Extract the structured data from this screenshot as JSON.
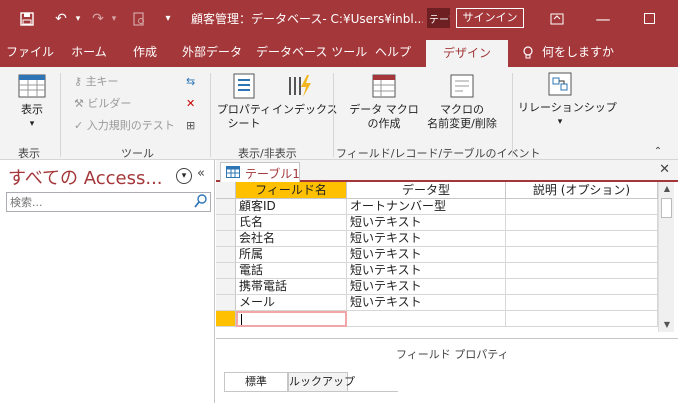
{
  "title_bar": {
    "title": "顧客管理：データベース- C:¥Users¥inbl...",
    "context_tab": "テーブル ツール",
    "signin_label": "サインイン"
  },
  "ribbon_tabs": [
    "ファイル",
    "ホーム",
    "作成",
    "外部データ",
    "データベース ツール",
    "ヘルプ",
    "デザイン"
  ],
  "tell_me": "何をしますか",
  "ribbon": {
    "view_label": "表示",
    "primary_key": "主キー",
    "builder": "ビルダー",
    "test_rules": "入力規則のテスト",
    "property_sheet": [
      "プロパティ",
      "シート"
    ],
    "indexes": "インデックス",
    "data_macro": [
      "データ マクロ",
      "の作成"
    ],
    "rename_macro": [
      "マクロの",
      "名前変更/削除"
    ],
    "relationships": "リレーションシップ",
    "groups": [
      "表示",
      "ツール",
      "表示/非表示",
      "フィールド/レコード/テーブルのイベント"
    ]
  },
  "nav_pane": {
    "title": "すべての Access...",
    "search_placeholder": "検索..."
  },
  "document": {
    "tab_label": "テーブル1",
    "columns": [
      "フィールド名",
      "データ型",
      "説明 (オプション)"
    ],
    "rows": [
      {
        "field": "顧客ID",
        "type": "オートナンバー型"
      },
      {
        "field": "氏名",
        "type": "短いテキスト"
      },
      {
        "field": "会社名",
        "type": "短いテキスト"
      },
      {
        "field": "所属",
        "type": "短いテキスト"
      },
      {
        "field": "電話",
        "type": "短いテキスト"
      },
      {
        "field": "携帯電話",
        "type": "短いテキスト"
      },
      {
        "field": "メール",
        "type": "短いテキスト"
      }
    ],
    "field_properties_label": "フィールド プロパティ",
    "property_tabs": [
      "標準",
      "ルックアップ"
    ]
  },
  "colors": {
    "accent": "#a4373a",
    "key": "#ffc000"
  }
}
